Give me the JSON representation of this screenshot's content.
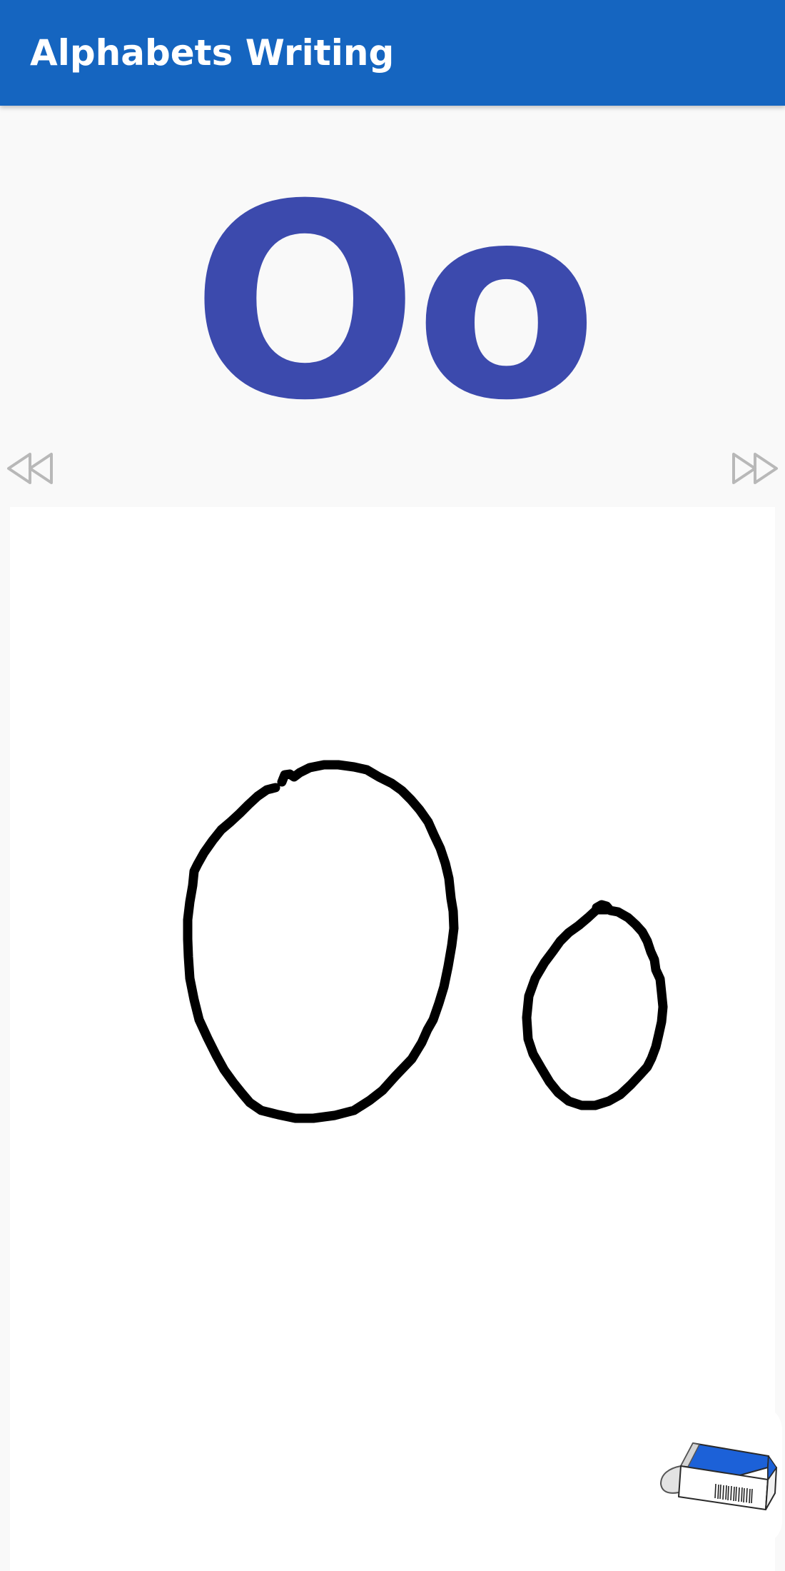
{
  "app_bar": {
    "title": "Alphabets Writing",
    "color": "#1565c0"
  },
  "letter": {
    "display": "Oo",
    "color": "#3c4aad"
  },
  "navigation": {
    "prev_icon": "rewind-icon",
    "next_icon": "fast-forward-icon"
  },
  "canvas": {
    "background": "#ffffff",
    "stroke_color": "#000000"
  },
  "tools": {
    "eraser_icon": "eraser-icon"
  }
}
